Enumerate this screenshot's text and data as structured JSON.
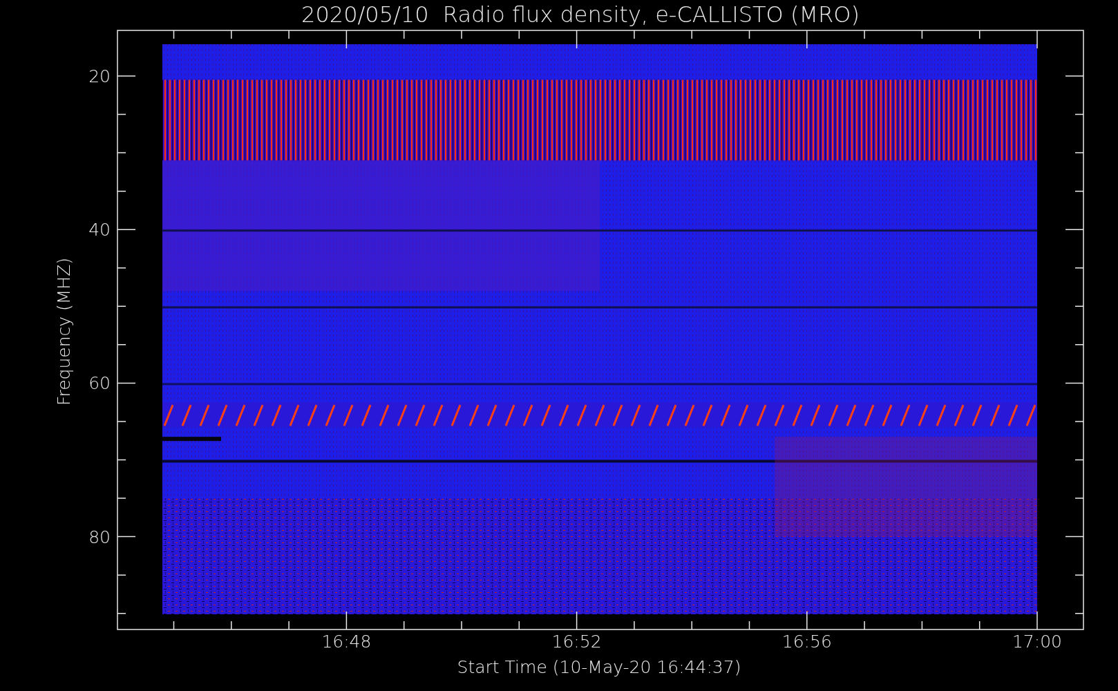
{
  "title": "2020/05/10  Radio flux density, e-CALLISTO (MRO)",
  "y_axis": {
    "label": "Frequency (MHZ)",
    "ticks": [
      "20",
      "40",
      "60",
      "80"
    ]
  },
  "x_axis": {
    "label": "Start Time (10-May-20 16:44:37)",
    "ticks": [
      "16:48",
      "16:52",
      "16:56",
      "17:00"
    ]
  }
}
